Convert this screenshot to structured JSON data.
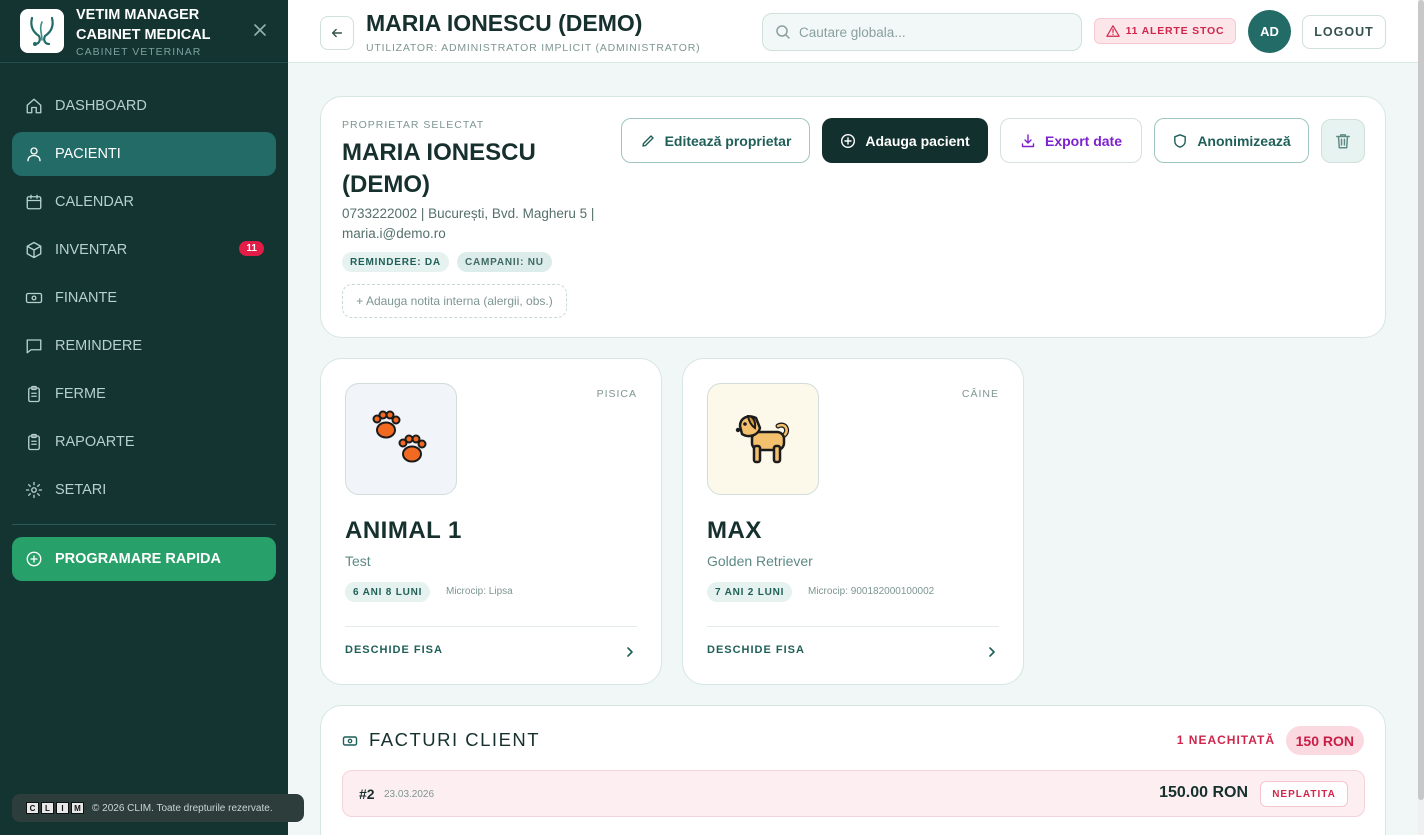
{
  "sidebar": {
    "brand_title_line1": "VETIM MANAGER",
    "brand_title_line2": "CABINET MEDICAL",
    "brand_subtitle": "CABINET VETERINAR",
    "items": [
      {
        "label": "DASHBOARD",
        "icon": "home-icon"
      },
      {
        "label": "PACIENTI",
        "icon": "user-icon",
        "active": true
      },
      {
        "label": "CALENDAR",
        "icon": "calendar-icon"
      },
      {
        "label": "INVENTAR",
        "icon": "box-icon",
        "badge": "11"
      },
      {
        "label": "FINANTE",
        "icon": "banknote-icon"
      },
      {
        "label": "REMINDERE",
        "icon": "message-icon"
      },
      {
        "label": "FERME",
        "icon": "clipboard-icon"
      },
      {
        "label": "RAPOARTE",
        "icon": "clipboard-icon"
      },
      {
        "label": "SETARI",
        "icon": "gear-icon"
      }
    ],
    "quick_action": "PROGRAMARE RAPIDA",
    "footer_letters": [
      "C",
      "L",
      "I",
      "M"
    ],
    "footer_text": "© 2026 CLIM. Toate drepturile rezervate."
  },
  "header": {
    "title": "MARIA IONESCU (DEMO)",
    "subtitle": "UTILIZATOR: ADMINISTRATOR IMPLICIT (ADMINISTRATOR)",
    "search_placeholder": "Cautare globala...",
    "stock_alert": "11 ALERTE STOC",
    "avatar_initials": "AD",
    "logout": "LOGOUT"
  },
  "owner": {
    "label": "PROPRIETAR SELECTAT",
    "name": "MARIA IONESCU (DEMO)",
    "info": "0733222002 | București, Bvd. Magheru 5 | maria.i@demo.ro",
    "tag_reminder": "REMINDERE: DA",
    "tag_campaign": "CAMPANII: NU",
    "note_placeholder": "+ Adauga notita interna (alergii, obs.)",
    "btn_edit": "Editează proprietar",
    "btn_add": "Adauga pacient",
    "btn_export": "Export date",
    "btn_anon": "Anonimizează"
  },
  "pets": [
    {
      "species": "PISICA",
      "name": "ANIMAL 1",
      "breed": "Test",
      "age": "6 ANI 8 LUNI",
      "chip": "Microcip: Lipsa",
      "open": "DESCHIDE FISA",
      "icon": "paw-prints-icon"
    },
    {
      "species": "CÂINE",
      "name": "MAX",
      "breed": "Golden Retriever",
      "age": "7 ANI 2 LUNI",
      "chip": "Microcip: 900182000100002",
      "open": "DESCHIDE FISA",
      "icon": "dog-icon"
    }
  ],
  "invoices": {
    "title": "FACTURI CLIENT",
    "unpaid_count": "1 NEACHITATĂ",
    "unpaid_sum": "150 RON",
    "rows": [
      {
        "number": "#2",
        "date": "23.03.2026",
        "amount": "150.00 RON",
        "status": "NEPLATITA"
      }
    ]
  },
  "colors": {
    "sidebar_bg": "#133431",
    "active_nav": "#226b66",
    "quick_action": "#28a06a",
    "alert": "#d0264b",
    "export": "#7e22ce"
  }
}
